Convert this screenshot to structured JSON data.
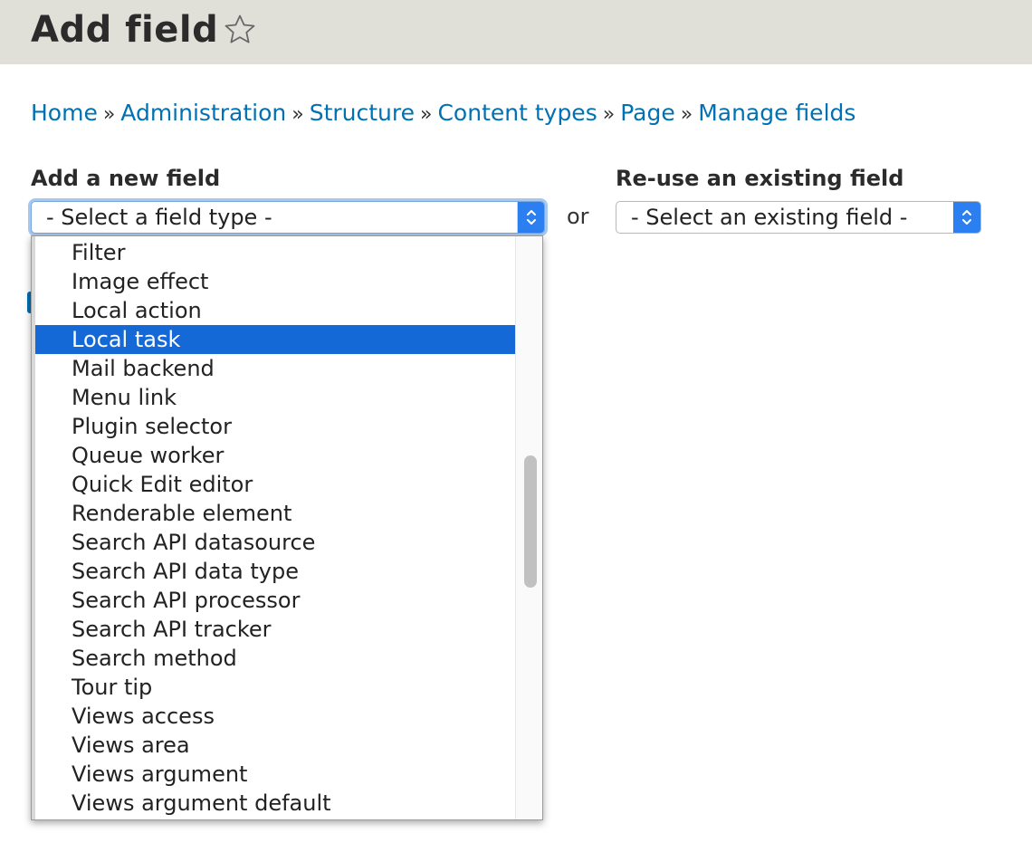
{
  "header": {
    "title": "Add field",
    "bg_color": "#e0e0d8",
    "star_icon": "star-outline-icon"
  },
  "breadcrumb": {
    "items": [
      "Home",
      "Administration",
      "Structure",
      "Content types",
      "Page",
      "Manage fields"
    ],
    "separator": "»",
    "link_color": "#0071b3"
  },
  "new_field": {
    "label": "Add a new field",
    "select_value": "- Select a field type -"
  },
  "or_text": "or",
  "existing_field": {
    "label": "Re-use an existing field",
    "select_value": "- Select an existing field -"
  },
  "dropdown": {
    "items": [
      "Filter",
      "Image effect",
      "Local action",
      "Local task",
      "Mail backend",
      "Menu link",
      "Plugin selector",
      "Queue worker",
      "Quick Edit editor",
      "Renderable element",
      "Search API datasource",
      "Search API data type",
      "Search API processor",
      "Search API tracker",
      "Search method",
      "Tour tip",
      "Views access",
      "Views area",
      "Views argument",
      "Views argument default"
    ],
    "highlighted": "Local task",
    "highlight_color": "#1469d7"
  }
}
